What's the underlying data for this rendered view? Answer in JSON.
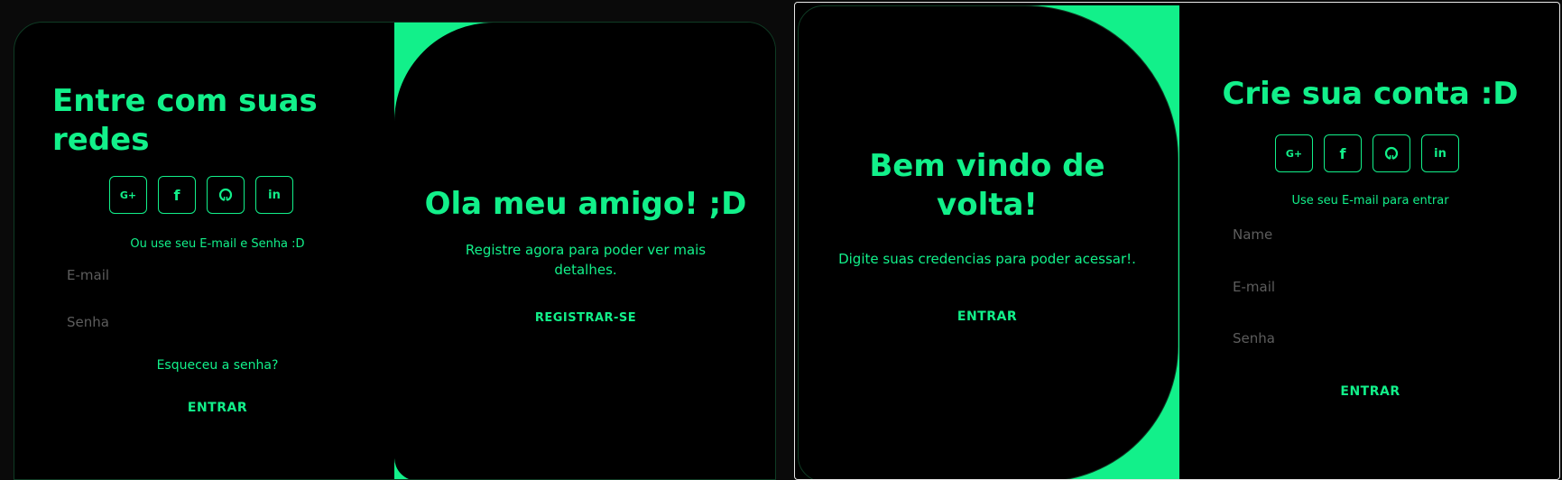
{
  "left": {
    "signin": {
      "title_line1": "Entre com suas",
      "title_line2": "redes",
      "social_labels": {
        "google": "G+",
        "facebook": "f",
        "github": "",
        "linkedin": "in"
      },
      "hint": "Ou use seu E-mail e Senha :D",
      "email_placeholder": "E-mail",
      "password_placeholder": "Senha",
      "forgot": "Esqueceu a senha?",
      "submit": "ENTRAR"
    },
    "overlay": {
      "title": "Ola meu amigo! ;D",
      "text_line1": "Registre agora para poder ver mais",
      "text_line2": "detalhes.",
      "button": "REGISTRAR-SE"
    }
  },
  "right": {
    "overlay": {
      "title_line1": "Bem vindo de",
      "title_line2": "volta!",
      "text": "Digite suas credencias para poder acessar!.",
      "button": "ENTRAR"
    },
    "signup": {
      "title": "Crie sua conta :D",
      "social_labels": {
        "google": "G+",
        "facebook": "f",
        "github": "",
        "linkedin": "in"
      },
      "hint": "Use seu E-mail para entrar",
      "name_placeholder": "Name",
      "email_placeholder": "E-mail",
      "password_placeholder": "Senha",
      "submit": "ENTRAR"
    }
  },
  "colors": {
    "accent": "#12f08a",
    "background": "#000000",
    "placeholder": "#5d5d5d"
  }
}
